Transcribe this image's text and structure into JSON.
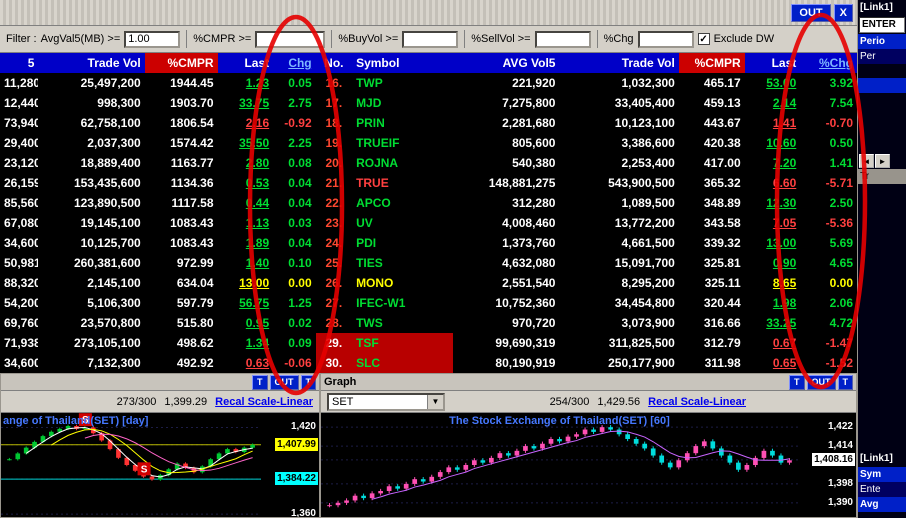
{
  "window": {
    "out_label": "OUT",
    "close_label": "X"
  },
  "filter": {
    "label": "Filter :",
    "fields": [
      {
        "label": "AvgVal5(MB) >=",
        "value": "1.00"
      },
      {
        "label": "%CMPR >=",
        "value": ""
      },
      {
        "label": "%BuyVol >=",
        "value": ""
      },
      {
        "label": "%SellVol >=",
        "value": ""
      },
      {
        "label": "%Chg",
        "value": ""
      }
    ],
    "exclude_dw": {
      "label": "Exclude DW",
      "checked": true
    }
  },
  "table": {
    "headers": [
      {
        "t": "5"
      },
      {
        "t": "Trade Vol"
      },
      {
        "t": "%CMPR",
        "cls": "hred"
      },
      {
        "t": "Last"
      },
      {
        "t": "Chg",
        "cls": "hlink"
      },
      {
        "t": "No."
      },
      {
        "t": "Symbol"
      },
      {
        "t": "AVG Vol5"
      },
      {
        "t": "Trade Vol"
      },
      {
        "t": "%CMPR",
        "cls": "hred"
      },
      {
        "t": "Last"
      },
      {
        "t": "%Chg",
        "cls": "hlink"
      }
    ],
    "rows": [
      [
        [
          "11,280",
          "cw"
        ],
        [
          "25,497,200",
          "cw"
        ],
        [
          "1944.45",
          "cw"
        ],
        [
          "1.23",
          "cg u"
        ],
        [
          "0.05",
          "cg"
        ],
        [
          "16.",
          "no"
        ],
        [
          "TWP",
          "cg"
        ],
        [
          "221,920",
          "cw"
        ],
        [
          "1,032,300",
          "cw"
        ],
        [
          "465.17",
          "cw"
        ],
        [
          "53.00",
          "cg u"
        ],
        [
          "3.92",
          "cg"
        ]
      ],
      [
        [
          "12,440",
          "cw"
        ],
        [
          "998,300",
          "cw"
        ],
        [
          "1903.70",
          "cw"
        ],
        [
          "33.75",
          "cg u"
        ],
        [
          "2.75",
          "cg"
        ],
        [
          "17.",
          "no"
        ],
        [
          "MJD",
          "cg"
        ],
        [
          "7,275,800",
          "cw"
        ],
        [
          "33,405,400",
          "cw"
        ],
        [
          "459.13",
          "cw"
        ],
        [
          "2.14",
          "cg u"
        ],
        [
          "7.54",
          "cg"
        ]
      ],
      [
        [
          "73,940",
          "cw"
        ],
        [
          "62,758,100",
          "cw"
        ],
        [
          "1806.54",
          "cw"
        ],
        [
          "2.16",
          "cr u"
        ],
        [
          "-0.92",
          "cr"
        ],
        [
          "18.",
          "no"
        ],
        [
          "PRIN",
          "cg"
        ],
        [
          "2,281,680",
          "cw"
        ],
        [
          "10,123,100",
          "cw"
        ],
        [
          "443.67",
          "cw"
        ],
        [
          "1.41",
          "cr u"
        ],
        [
          "-0.70",
          "cr"
        ]
      ],
      [
        [
          "29,400",
          "cw"
        ],
        [
          "2,037,300",
          "cw"
        ],
        [
          "1574.42",
          "cw"
        ],
        [
          "35.50",
          "cg u"
        ],
        [
          "2.25",
          "cg"
        ],
        [
          "19.",
          "no"
        ],
        [
          "TRUEIF",
          "cg"
        ],
        [
          "805,600",
          "cw"
        ],
        [
          "3,386,600",
          "cw"
        ],
        [
          "420.38",
          "cw"
        ],
        [
          "10.60",
          "cg u"
        ],
        [
          "0.50",
          "cg"
        ]
      ],
      [
        [
          "23,120",
          "cw"
        ],
        [
          "18,889,400",
          "cw"
        ],
        [
          "1163.77",
          "cw"
        ],
        [
          "2.80",
          "cg u"
        ],
        [
          "0.08",
          "cg"
        ],
        [
          "20.",
          "no"
        ],
        [
          "ROJNA",
          "cg"
        ],
        [
          "540,380",
          "cw"
        ],
        [
          "2,253,400",
          "cw"
        ],
        [
          "417.00",
          "cw"
        ],
        [
          "7.20",
          "cg u"
        ],
        [
          "1.41",
          "cg"
        ]
      ],
      [
        [
          "26,159",
          "cw"
        ],
        [
          "153,435,600",
          "cw"
        ],
        [
          "1134.36",
          "cw"
        ],
        [
          "0.53",
          "cg u"
        ],
        [
          "0.04",
          "cg"
        ],
        [
          "21.",
          "no"
        ],
        [
          "TRUE",
          "cr"
        ],
        [
          "148,881,275",
          "cw"
        ],
        [
          "543,900,500",
          "cw"
        ],
        [
          "365.32",
          "cw"
        ],
        [
          "6.60",
          "cr u"
        ],
        [
          "-5.71",
          "cr"
        ]
      ],
      [
        [
          "85,560",
          "cw"
        ],
        [
          "123,890,500",
          "cw"
        ],
        [
          "1117.58",
          "cw"
        ],
        [
          "0.44",
          "cg u"
        ],
        [
          "0.04",
          "cg"
        ],
        [
          "22.",
          "no"
        ],
        [
          "APCO",
          "cg"
        ],
        [
          "312,280",
          "cw"
        ],
        [
          "1,089,500",
          "cw"
        ],
        [
          "348.89",
          "cw"
        ],
        [
          "12.30",
          "cg u"
        ],
        [
          "2.50",
          "cg"
        ]
      ],
      [
        [
          "67,080",
          "cw"
        ],
        [
          "19,145,100",
          "cw"
        ],
        [
          "1083.43",
          "cw"
        ],
        [
          "1.13",
          "cg u"
        ],
        [
          "0.03",
          "cg"
        ],
        [
          "23.",
          "no"
        ],
        [
          "UV",
          "cg"
        ],
        [
          "4,008,460",
          "cw"
        ],
        [
          "13,772,200",
          "cw"
        ],
        [
          "343.58",
          "cw"
        ],
        [
          "7.05",
          "cr u"
        ],
        [
          "-5.36",
          "cr"
        ]
      ],
      [
        [
          "34,600",
          "cw"
        ],
        [
          "10,125,700",
          "cw"
        ],
        [
          "1083.43",
          "cw"
        ],
        [
          "1.89",
          "cg u"
        ],
        [
          "0.04",
          "cg"
        ],
        [
          "24.",
          "no"
        ],
        [
          "PDI",
          "cg"
        ],
        [
          "1,373,760",
          "cw"
        ],
        [
          "4,661,500",
          "cw"
        ],
        [
          "339.32",
          "cw"
        ],
        [
          "13.00",
          "cg u"
        ],
        [
          "5.69",
          "cg"
        ]
      ],
      [
        [
          "50,981",
          "cw"
        ],
        [
          "260,381,600",
          "cw"
        ],
        [
          "972.99",
          "cw"
        ],
        [
          "1.40",
          "cg u"
        ],
        [
          "0.10",
          "cg"
        ],
        [
          "25.",
          "no"
        ],
        [
          "TIES",
          "cg"
        ],
        [
          "4,632,080",
          "cw"
        ],
        [
          "15,091,700",
          "cw"
        ],
        [
          "325.81",
          "cw"
        ],
        [
          "0.90",
          "cg u"
        ],
        [
          "4.65",
          "cg"
        ]
      ],
      [
        [
          "88,320",
          "cw"
        ],
        [
          "2,145,100",
          "cw"
        ],
        [
          "634.04",
          "cw"
        ],
        [
          "13.00",
          "cy u"
        ],
        [
          "0.00",
          "cy"
        ],
        [
          "26.",
          "no"
        ],
        [
          "MONO",
          "cy"
        ],
        [
          "2,551,540",
          "cw"
        ],
        [
          "8,295,200",
          "cw"
        ],
        [
          "325.11",
          "cw"
        ],
        [
          "8.65",
          "cy u"
        ],
        [
          "0.00",
          "cy"
        ]
      ],
      [
        [
          "54,200",
          "cw"
        ],
        [
          "5,106,300",
          "cw"
        ],
        [
          "597.79",
          "cw"
        ],
        [
          "56.75",
          "cg u"
        ],
        [
          "1.25",
          "cg"
        ],
        [
          "27.",
          "no"
        ],
        [
          "IFEC-W1",
          "cg"
        ],
        [
          "10,752,360",
          "cw"
        ],
        [
          "34,454,800",
          "cw"
        ],
        [
          "320.44",
          "cw"
        ],
        [
          "1.98",
          "cg u"
        ],
        [
          "2.06",
          "cg"
        ]
      ],
      [
        [
          "69,760",
          "cw"
        ],
        [
          "23,570,800",
          "cw"
        ],
        [
          "515.80",
          "cw"
        ],
        [
          "0.95",
          "cg u"
        ],
        [
          "0.02",
          "cg"
        ],
        [
          "28.",
          "no"
        ],
        [
          "TWS",
          "cg"
        ],
        [
          "970,720",
          "cw"
        ],
        [
          "3,073,900",
          "cw"
        ],
        [
          "316.66",
          "cw"
        ],
        [
          "33.25",
          "cg u"
        ],
        [
          "4.72",
          "cg"
        ]
      ],
      [
        [
          "71,938",
          "cw"
        ],
        [
          "273,105,100",
          "cw"
        ],
        [
          "498.62",
          "cw"
        ],
        [
          "1.34",
          "cg u"
        ],
        [
          "0.09",
          "cg"
        ],
        [
          "29.",
          "no hl"
        ],
        [
          "TSF",
          "symhl"
        ],
        [
          "99,690,319",
          "cw"
        ],
        [
          "311,825,500",
          "cw"
        ],
        [
          "312.79",
          "cw"
        ],
        [
          "0.67",
          "cr u"
        ],
        [
          "-1.47",
          "cr"
        ]
      ],
      [
        [
          "34,600",
          "cw"
        ],
        [
          "7,132,300",
          "cw"
        ],
        [
          "492.92",
          "cw"
        ],
        [
          "0.63",
          "cr u"
        ],
        [
          "-0.06",
          "cr"
        ],
        [
          "30.",
          "no hl"
        ],
        [
          "SLC",
          "symhl"
        ],
        [
          "80,190,919",
          "cw"
        ],
        [
          "250,177,900",
          "cw"
        ],
        [
          "311.98",
          "cw"
        ],
        [
          "0.65",
          "cr u"
        ],
        [
          "-1.52",
          "cr"
        ]
      ]
    ]
  },
  "left_chart": {
    "buttons": [
      "T",
      "OUT",
      "T"
    ],
    "counter": "273/300",
    "value": "1,399.29",
    "recal": "Recal Scale-Linear",
    "title": "ange of Thailand(SET)  [day]",
    "ylim": [
      1358,
      1430
    ],
    "closes": [
      1398,
      1402,
      1406,
      1410,
      1414,
      1417,
      1419,
      1421,
      1419,
      1420,
      1416,
      1411,
      1405,
      1399,
      1394,
      1390,
      1386,
      1384,
      1387,
      1391,
      1395,
      1392,
      1389,
      1393,
      1398,
      1402,
      1405,
      1403,
      1406,
      1408
    ],
    "up": "#00c832",
    "down": "#ff3232",
    "hlines": [
      {
        "v": 1407.99,
        "color": "#b8b800"
      },
      {
        "v": 1384.22,
        "color": "#00d2d2"
      }
    ],
    "mas": [
      {
        "period": 3,
        "color": "#ffffff"
      },
      {
        "period": 6,
        "color": "#ffff00"
      },
      {
        "period": 10,
        "color": "#ff64c8"
      }
    ],
    "markers": [
      {
        "i": 9,
        "v": 1425,
        "label": "S"
      },
      {
        "i": 16,
        "v": 1391,
        "label": "S"
      }
    ],
    "axis": [
      {
        "text": "1,420"
      },
      {
        "text": "1,407.99",
        "bg": "#ffff00"
      },
      {
        "text": "1,384.22",
        "bg": "#00ffff"
      },
      {
        "text": "1,360"
      }
    ]
  },
  "right_chart": {
    "panel_title": "Graph",
    "buttons": [
      "T",
      "OUT",
      "T"
    ],
    "select_value": "SET",
    "counter": "254/300",
    "value": "1,429.56",
    "recal": "Recal Scale-Linear",
    "title": "The Stock Exchange of Thailand(SET)  [60]",
    "ylim": [
      1384,
      1428
    ],
    "closes": [
      1389,
      1390,
      1391,
      1393,
      1392,
      1394,
      1395,
      1397,
      1396,
      1398,
      1400,
      1399,
      1401,
      1403,
      1405,
      1404,
      1406,
      1408,
      1407,
      1409,
      1411,
      1410,
      1412,
      1414,
      1413,
      1415,
      1417,
      1416,
      1418,
      1419,
      1421,
      1420,
      1422,
      1421,
      1419,
      1417,
      1415,
      1413,
      1410,
      1407,
      1405,
      1408,
      1411,
      1414,
      1416,
      1413,
      1410,
      1407,
      1404,
      1406,
      1409,
      1412,
      1410,
      1407,
      1408
    ],
    "up": "#ff50b4",
    "down": "#00dcdc",
    "hlines": [],
    "mas": [
      {
        "period": 6,
        "color": "#c864ff"
      }
    ],
    "markers": [],
    "axis": [
      {
        "text": "1,422"
      },
      {
        "text": "1,414"
      },
      {
        "text": "1,408.16",
        "bg": "#ffffff"
      },
      {
        "text": "1,398"
      },
      {
        "text": "1,390"
      }
    ]
  },
  "sidebar_top": {
    "title": "[Link1]",
    "input": "ENTER",
    "row1": "Perio",
    "row2": "Per",
    "prev": "◄",
    "next": "►",
    "tr_label": "Tr"
  },
  "sidebar_bottom": {
    "title": "[Link1]",
    "row1": "Sym",
    "row2": "Ente",
    "row3": "Avg"
  },
  "annotation": {
    "color": "#e60000"
  }
}
